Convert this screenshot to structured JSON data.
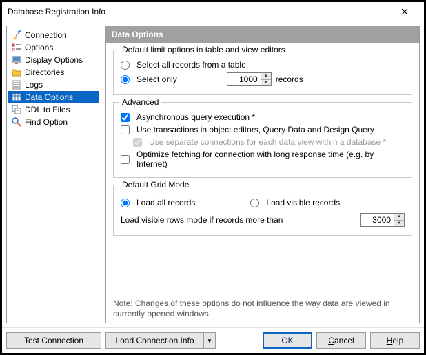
{
  "title": "Database Registration Info",
  "sidebar": {
    "items": [
      {
        "label": "Connection"
      },
      {
        "label": "Options"
      },
      {
        "label": "Display Options"
      },
      {
        "label": "Directories"
      },
      {
        "label": "Logs"
      },
      {
        "label": "Data Options"
      },
      {
        "label": "DDL to Files"
      },
      {
        "label": "Find Option"
      }
    ]
  },
  "panel": {
    "header": "Data Options",
    "group1": {
      "title": "Default limit options in table and view editors",
      "opt_all": "Select all records from a table",
      "opt_only": "Select only",
      "opt_only_value": "1000",
      "opt_only_suffix": "records"
    },
    "group2": {
      "title": "Advanced",
      "async": "Asynchronous query execution *",
      "txn": "Use transactions in object editors, Query Data and Design Query",
      "sep_conn": "Use separate connections for each data view within a database *",
      "optimize": "Optimize fetching for connection with long response time (e.g. by Internet)"
    },
    "group3": {
      "title": "Default Grid Mode",
      "load_all": "Load all records",
      "load_vis": "Load visible records",
      "rows_label": "Load visible rows mode if records more than",
      "rows_value": "3000"
    },
    "note": "Note: Changes of these options do not influence the way data are viewed in currently opened windows."
  },
  "footer": {
    "test": "Test Connection",
    "load": "Load Connection Info",
    "ok": "OK",
    "cancel_pre": "",
    "cancel_u": "C",
    "cancel_post": "ancel",
    "help_pre": "",
    "help_u": "H",
    "help_post": "elp"
  }
}
